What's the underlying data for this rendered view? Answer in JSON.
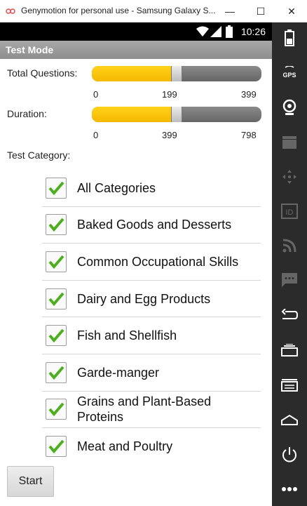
{
  "window": {
    "title": "Genymotion for personal use - Samsung Galaxy S...",
    "minimize_glyph": "—",
    "maximize_glyph": "☐",
    "close_glyph": "✕"
  },
  "statusbar": {
    "time": "10:26"
  },
  "actionbar": {
    "title": "Test Mode"
  },
  "questions": {
    "label": "Total Questions:",
    "min": "0",
    "value": "199",
    "max": "399",
    "fraction": 0.5
  },
  "duration": {
    "label": "Duration:",
    "min": "0",
    "value": "399",
    "max": "798",
    "fraction": 0.5
  },
  "category": {
    "label": "Test Category:",
    "items": [
      {
        "label": "All Categories",
        "checked": true
      },
      {
        "label": "Baked Goods and Desserts",
        "checked": true
      },
      {
        "label": "Common Occupational Skills",
        "checked": true
      },
      {
        "label": "Dairy and Egg Products",
        "checked": true
      },
      {
        "label": "Fish and Shellfish",
        "checked": true
      },
      {
        "label": "Garde-manger",
        "checked": true
      },
      {
        "label": "Grains and Plant-Based Proteins",
        "checked": true
      },
      {
        "label": "Meat and Poultry",
        "checked": true
      }
    ]
  },
  "start_label": "Start",
  "sidebar": {
    "gps_label": "GPS",
    "id_label": "ID",
    "icons": [
      "battery-icon",
      "gps-icon",
      "camera-icon",
      "media-icon",
      "dpad-icon",
      "id-icon",
      "rss-icon",
      "sms-icon",
      "back-icon",
      "recent-apps-icon",
      "menu-icon",
      "home-icon",
      "power-icon",
      "more-icon"
    ]
  },
  "colors": {
    "accent": "#f5b800",
    "check": "#4caf1e",
    "sidebar": "#2b2b2b"
  }
}
